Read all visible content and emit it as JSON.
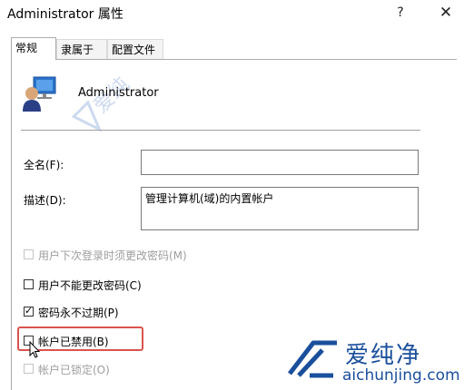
{
  "window": {
    "title": "Administrator 属性",
    "help_glyph": "?",
    "close_glyph": "✕"
  },
  "tabs": [
    {
      "label": "常规",
      "active": true
    },
    {
      "label": "隶属于",
      "active": false
    },
    {
      "label": "配置文件",
      "active": false
    }
  ],
  "user": {
    "name": "Administrator",
    "icon": "user-account-icon"
  },
  "form": {
    "fullname_label": "全名(F):",
    "fullname_value": "",
    "description_label": "描述(D):",
    "description_value": "管理计算机(域)的内置帐户"
  },
  "options": [
    {
      "label": "用户下次登录时须更改密码(M)",
      "checked": false,
      "disabled": true
    },
    {
      "label": "用户不能更改密码(C)",
      "checked": false,
      "disabled": false
    },
    {
      "label": "密码永不过期(P)",
      "checked": true,
      "disabled": false
    },
    {
      "label": "帐户已禁用(B)",
      "checked": false,
      "disabled": false
    },
    {
      "label": "帐户已锁定(O)",
      "checked": false,
      "disabled": true
    }
  ],
  "watermark": {
    "brand": "爱纯净",
    "url": "aichunjing.com",
    "color": "#1a4f9c"
  },
  "colors": {
    "highlight": "#d9534f"
  }
}
